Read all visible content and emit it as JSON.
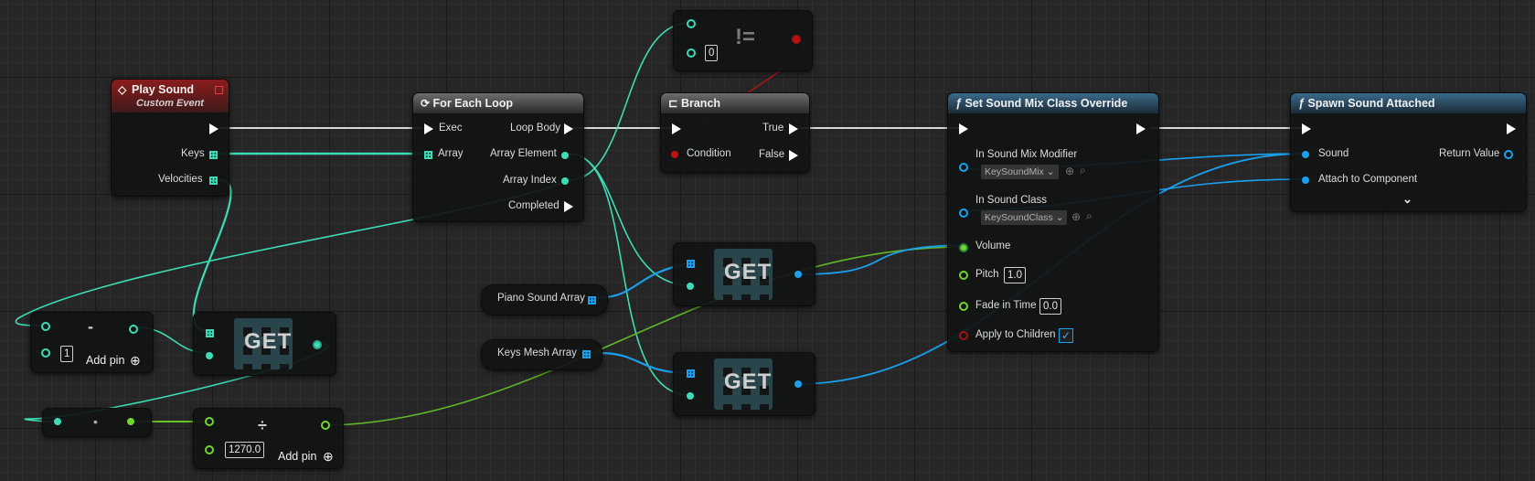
{
  "nodes": {
    "play_sound": {
      "title": "Play Sound",
      "subtitle": "Custom Event",
      "keys": "Keys",
      "velocities": "Velocities",
      "icon": "diamond-icon"
    },
    "for_each": {
      "title": "For Each Loop",
      "exec": "Exec",
      "array": "Array",
      "loop_body": "Loop Body",
      "array_element": "Array Element",
      "array_index": "Array Index",
      "completed": "Completed",
      "icon": "loop-icon"
    },
    "not_equal": {
      "op": "!=",
      "value": "0"
    },
    "branch": {
      "title": "Branch",
      "condition": "Condition",
      "true_label": "True",
      "false_label": "False",
      "icon": "branch-icon"
    },
    "set_mix": {
      "title": "Set Sound Mix Class Override",
      "modifier_label": "In Sound Mix Modifier",
      "modifier_value": "KeySoundMix",
      "class_label": "In Sound Class",
      "class_value": "KeySoundClass",
      "volume": "Volume",
      "pitch": "Pitch",
      "pitch_value": "1.0",
      "fade": "Fade in Time",
      "fade_value": "0.0",
      "apply": "Apply to Children",
      "apply_checked": "✓",
      "icon": "function-icon"
    },
    "spawn": {
      "title": "Spawn Sound Attached",
      "sound": "Sound",
      "return_value": "Return Value",
      "attach": "Attach to Component",
      "icon": "function-icon"
    },
    "piano_array": {
      "label": "Piano Sound Array"
    },
    "keys_mesh": {
      "label": "Keys Mesh Array"
    },
    "get_top": {
      "label": "GET"
    },
    "get_bottom": {
      "label": "GET"
    },
    "get_left": {
      "label": "GET"
    },
    "subtract": {
      "op": "-",
      "value": "1",
      "add_pin": "Add pin"
    },
    "reroute": {
      "dot": "•"
    },
    "divide": {
      "op": "÷",
      "value": "1270.0",
      "add_pin": "Add pin"
    }
  },
  "colors": {
    "exec": "#ffffff",
    "int": "#3ddcb6",
    "object": "#1aa0ee",
    "float": "#72d62c",
    "bool": "#c21010"
  }
}
